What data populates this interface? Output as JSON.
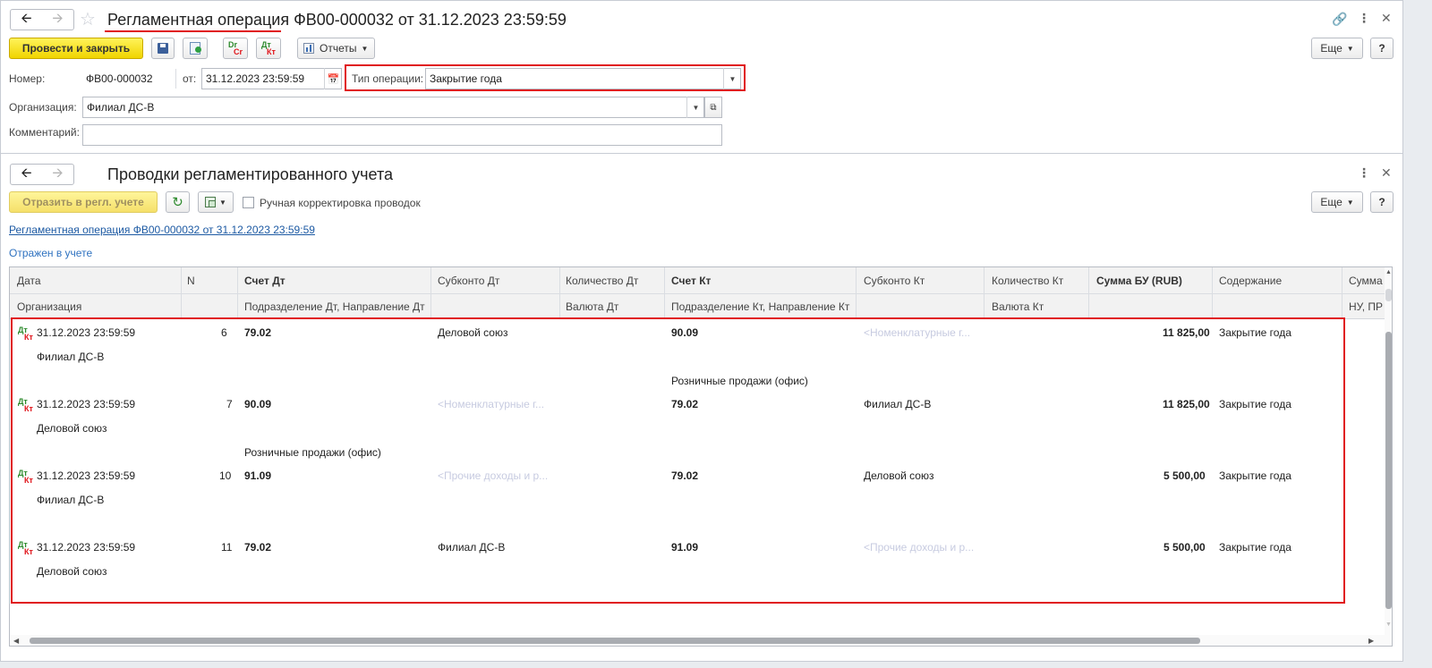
{
  "doc": {
    "title": "Регламентная операция ФВ00-000032 от 31.12.2023 23:59:59",
    "post_close_label": "Провести и закрыть",
    "dt_ct_icon": {
      "top": "Dr",
      "bottom": "Cr"
    },
    "dt_kt_icon": {
      "top": "Дт",
      "bottom": "Кт"
    },
    "reports_label": "Отчеты",
    "more_label": "Еще",
    "help_label": "?",
    "number_label": "Номер:",
    "number_value": "ФВ00-000032",
    "date_label": "от:",
    "date_value": "31.12.2023 23:59:59",
    "op_type_label": "Тип операции:",
    "op_type_value": "Закрытие года",
    "org_label": "Организация:",
    "org_value": "Филиал ДС-В",
    "comment_label": "Комментарий:",
    "comment_value": ""
  },
  "entries": {
    "title": "Проводки регламентированного учета",
    "reflect_label": "Отразить в регл. учете",
    "manual_label": "Ручная корректировка проводок",
    "more_label": "Еще",
    "help_label": "?",
    "doc_link": "Регламентная операция ФВ00-000032 от 31.12.2023 23:59:59",
    "status": "Отражен в учете"
  },
  "table": {
    "headers": {
      "date": "Дата",
      "n": "N",
      "acc_dt": "Счет Дт",
      "sub_dt": "Субконто Дт",
      "qty_dt": "Количество Дт",
      "acc_kt": "Счет Кт",
      "sub_kt": "Субконто Кт",
      "qty_kt": "Количество Кт",
      "sum": "Сумма БУ (RUB)",
      "content": "Содержание",
      "sum_nu": "Сумма",
      "org": "Организация",
      "div_dt": "Подразделение Дт, Направление Дт",
      "cur_dt": "Валюта Дт",
      "div_kt": "Подразделение Кт, Направление Кт",
      "cur_kt": "Валюта Кт",
      "nu": "НУ, ПР"
    },
    "rows": [
      {
        "date": "31.12.2023 23:59:59",
        "n": "6",
        "acc_dt": "79.02",
        "sub_dt": "Деловой союз",
        "acc_kt": "90.09",
        "sub_kt": "<Номенклатурные г...",
        "sum": "11 825,00",
        "content": "Закрытие года",
        "org": "Филиал ДС-В",
        "div_dt": "",
        "div_kt": "Розничные продажи (офис)"
      },
      {
        "date": "31.12.2023 23:59:59",
        "n": "7",
        "acc_dt": "90.09",
        "sub_dt": "<Номенклатурные г...",
        "acc_kt": "79.02",
        "sub_kt": "Филиал ДС-В",
        "sum": "11 825,00",
        "content": "Закрытие года",
        "org": "Деловой союз",
        "div_dt": "Розничные продажи (офис)",
        "div_kt": ""
      },
      {
        "date": "31.12.2023 23:59:59",
        "n": "10",
        "acc_dt": "91.09",
        "sub_dt": "<Прочие доходы и р...",
        "acc_kt": "79.02",
        "sub_kt": "Деловой союз",
        "sum": "5 500,00",
        "content": "Закрытие года",
        "org": "Филиал ДС-В",
        "div_dt": "",
        "div_kt": ""
      },
      {
        "date": "31.12.2023 23:59:59",
        "n": "11",
        "acc_dt": "79.02",
        "sub_dt": "Филиал ДС-В",
        "acc_kt": "91.09",
        "sub_kt": "<Прочие доходы и р...",
        "sum": "5 500,00",
        "content": "Закрытие года",
        "org": "Деловой союз",
        "div_dt": "",
        "div_kt": ""
      }
    ]
  },
  "colors": {
    "accent_red": "#e0151b",
    "button_yellow": "#fff35a",
    "link_blue": "#1d5aa3"
  }
}
